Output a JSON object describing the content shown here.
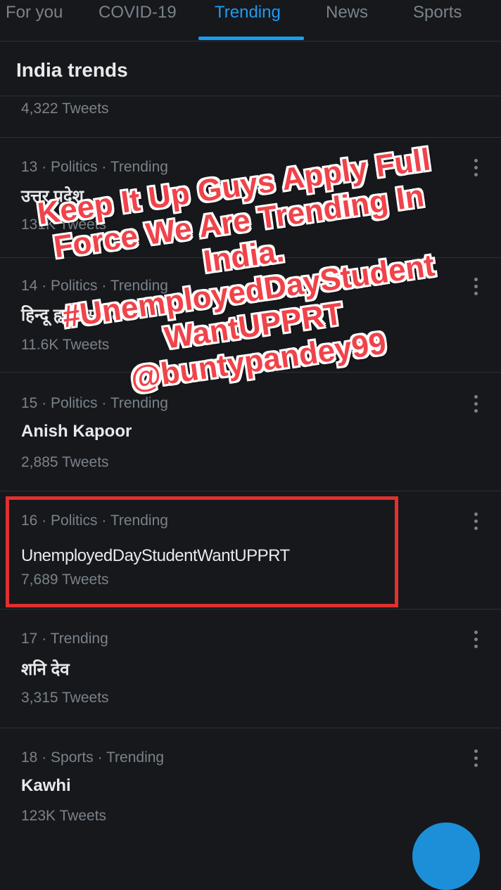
{
  "tabs": [
    {
      "label": "For you"
    },
    {
      "label": "COVID-19"
    },
    {
      "label": "Trending"
    },
    {
      "label": "News"
    },
    {
      "label": "Sports"
    }
  ],
  "active_tab": "Trending",
  "section_title": "India trends",
  "top_partial_count": "4,322 Tweets",
  "trends": [
    {
      "meta": "13 · Politics · Trending",
      "name": "उत्तर प्रदेश",
      "count": "131K Tweets"
    },
    {
      "meta": "14 · Politics · Trending",
      "name": "हिन्दू हृदय सम्राट",
      "count": "11.6K Tweets"
    },
    {
      "meta": "15 · Politics · Trending",
      "name": "Anish Kapoor",
      "count": "2,885 Tweets"
    },
    {
      "meta": "16 · Politics · Trending",
      "name": "UnemployedDayStudentWantUPPRT",
      "count": "7,689 Tweets"
    },
    {
      "meta": "17 · Trending",
      "name": "शनि देव",
      "count": "3,315 Tweets"
    },
    {
      "meta": "18 · Sports · Trending",
      "name": "Kawhi",
      "count": "123K Tweets"
    }
  ],
  "overlay_lines": [
    "Keep It Up Guys Apply Full",
    "Force We Are Trending In",
    "India.",
    "#UnemployedDayStudent",
    "WantUPPRT",
    "@buntypandey99"
  ],
  "colors": {
    "background": "#16181c",
    "accent": "#1d9bf0",
    "secondary_text": "#7a828a",
    "highlight_border": "#e0302f",
    "overlay_text": "#f0434a"
  },
  "icons": {
    "more": "more-vertical-icon",
    "compose": "compose-fab-icon"
  }
}
